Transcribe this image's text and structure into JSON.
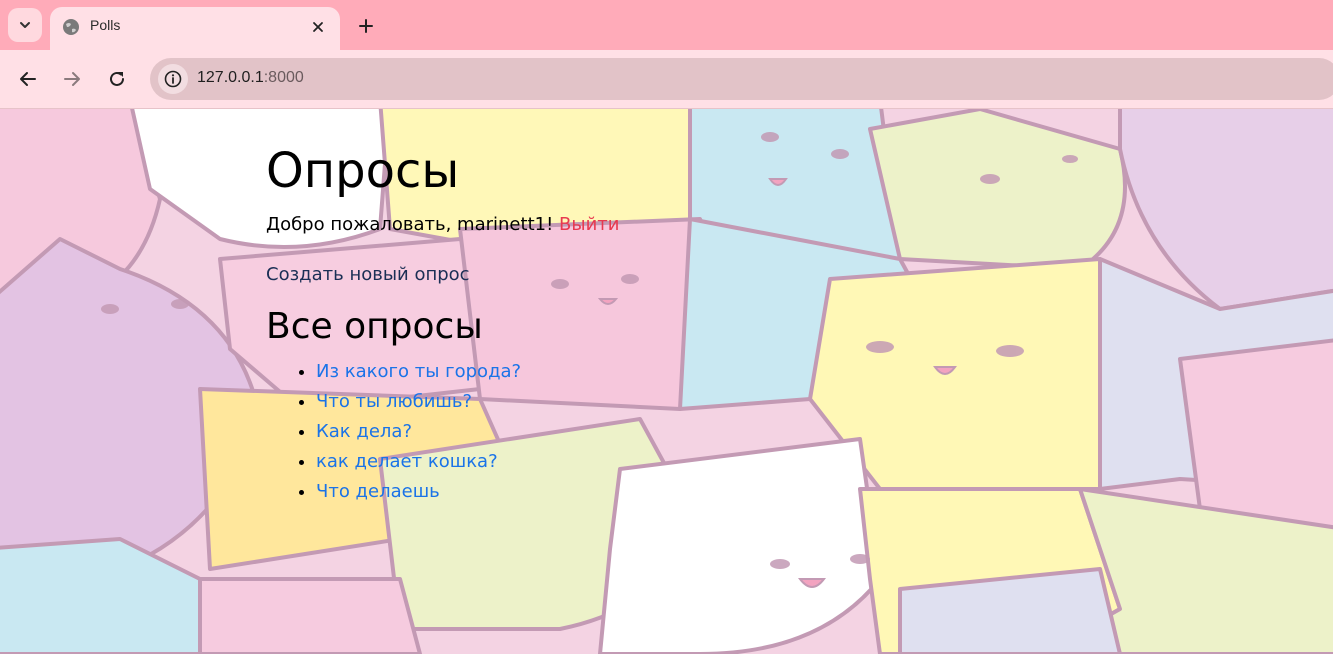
{
  "browser": {
    "tab_title": "Polls",
    "url_host": "127.0.0.1",
    "url_port": ":8000"
  },
  "page": {
    "title": "Опросы",
    "welcome_text": "Добро пожаловать, marinett1!",
    "logout_label": "Выйти",
    "create_link": "Создать новый опрос",
    "section_title": "Все опросы",
    "polls": [
      "Из какого ты города?",
      "Что ты любишь?",
      "Как дела?",
      "как делает кошка?",
      "Что делаешь"
    ]
  },
  "colors": {
    "tabbar": "#ffabb9",
    "toolbar": "#ffe0e6",
    "link": "#1a73e8",
    "logout": "#e8394f",
    "create_link": "#1b2f55"
  },
  "icons": {
    "tab_list": "chevron-down-icon",
    "favicon": "globe-icon",
    "tab_close": "close-icon",
    "new_tab": "plus-icon",
    "back": "back-arrow-icon",
    "forward": "forward-arrow-icon",
    "reload": "reload-icon",
    "site_info": "info-icon"
  }
}
